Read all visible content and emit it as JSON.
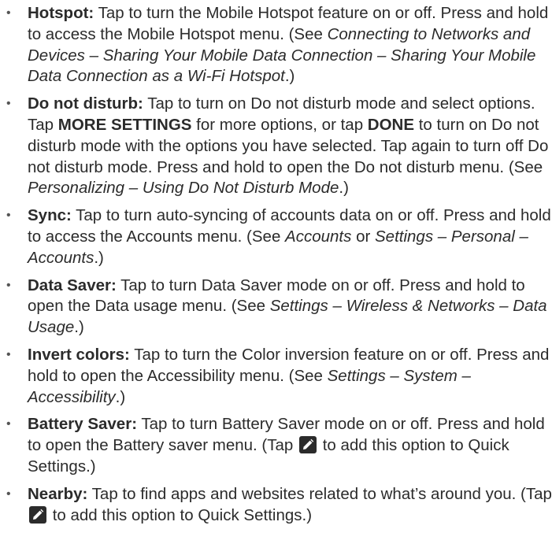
{
  "items": [
    {
      "term": "Hotspot:",
      "t1": " Tap to turn the Mobile Hotspot feature on or off. Press and hold to access the Mobile Hotspot menu. (See ",
      "ref": "Connecting to Networks and Devices – Sharing Your Mobile Data Connection – Sharing Your Mobile Data Connection as a Wi-Fi Hotspot",
      "t2": ".)"
    },
    {
      "term": "Do not disturb:",
      "t1": " Tap to turn on Do not disturb mode and select options. Tap ",
      "btn1": "MORE SETTINGS",
      "t2": " for more options, or tap ",
      "btn2": "DONE",
      "t3": " to turn on Do not disturb mode with the options you have selected. Tap again to turn off Do not disturb mode. Press and hold to open the Do not disturb menu. (See ",
      "ref": "Personalizing – Using Do Not Disturb Mode",
      "t4": ".)"
    },
    {
      "term": "Sync:",
      "t1": " Tap to turn auto-syncing of accounts data on or off. Press and hold to access the Accounts menu. (See ",
      "ref1": "Accounts",
      "t2": " or ",
      "ref2": "Settings – Personal – Accounts",
      "t3": ".)"
    },
    {
      "term": "Data Saver:",
      "t1": " Tap to turn Data Saver mode on or off. Press and hold to open the Data usage menu. (See ",
      "ref": "Settings – Wireless & Networks – Data Usage",
      "t2": ".)"
    },
    {
      "term": "Invert colors:",
      "t1": " Tap to turn the Color inversion feature on or off. Press and hold to open the Accessibility menu. (See ",
      "ref": "Settings – System – Accessibility",
      "t2": ".)"
    },
    {
      "term": "Battery Saver:",
      "t1": " Tap to turn Battery Saver mode on or off. Press and hold to open the Battery saver menu. (Tap ",
      "icon": "edit-pencil-icon",
      "t2": " to add this option to Quick Settings.)"
    },
    {
      "term": "Nearby:",
      "t1": " Tap to find apps and websites related to what’s around you. (Tap ",
      "icon": "edit-pencil-icon",
      "t2": " to add this option to Quick Settings.)"
    }
  ],
  "bullet_char": "•",
  "colors": {
    "text": "#2b2b2b",
    "icon_bg": "#2b2b2b",
    "icon_fg": "#ffffff"
  }
}
